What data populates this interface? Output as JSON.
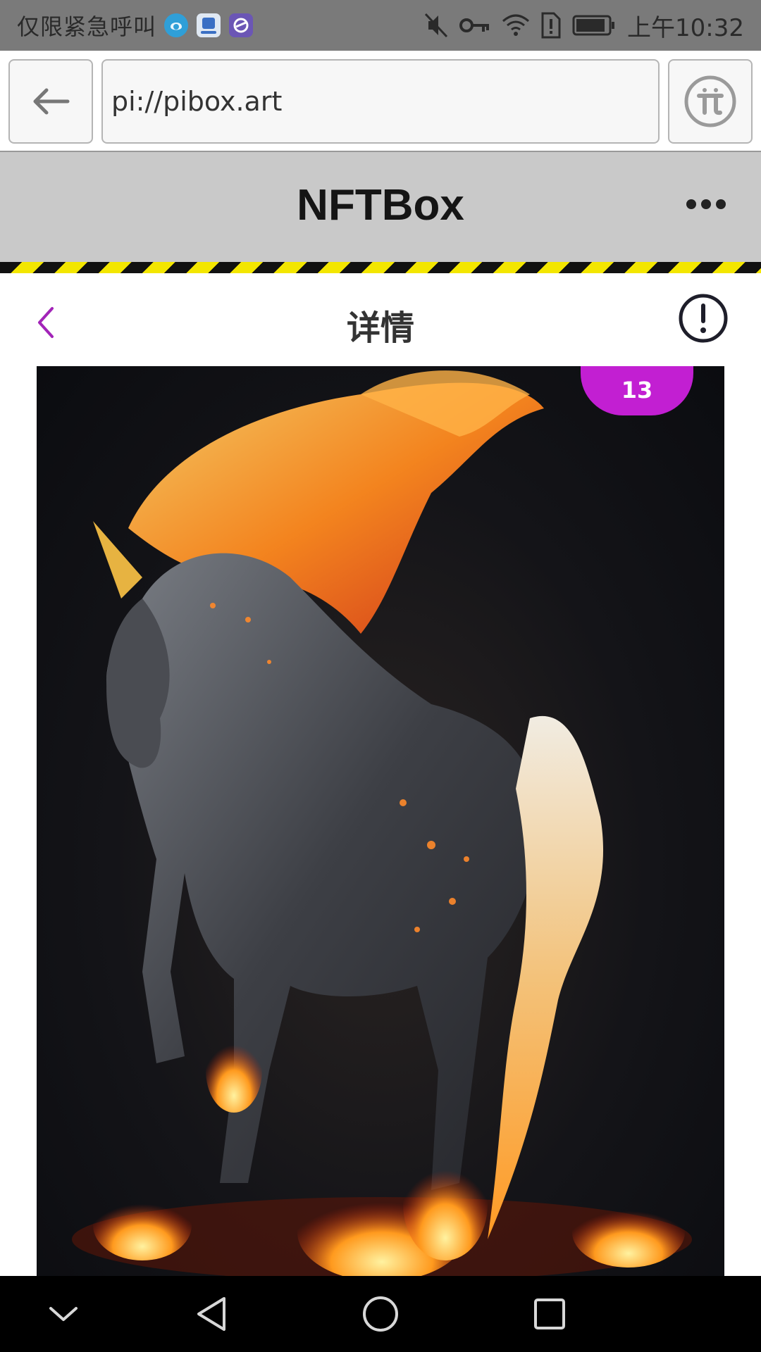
{
  "status_bar": {
    "carrier_text": "仅限紧急呼叫",
    "time": "上午10:32",
    "icons": [
      "weibo-icon",
      "app-store-icon",
      "browser-icon",
      "mute-icon",
      "vpn-key-icon",
      "wifi-icon",
      "sim-alert-icon",
      "battery-icon"
    ]
  },
  "browser": {
    "url": "pi://pibox.art",
    "icons": [
      "back-arrow-icon",
      "pi-logo-icon"
    ]
  },
  "app_header": {
    "title": "NFTBox",
    "more_icon": "more-dots-icon"
  },
  "page_nav": {
    "title": "详情",
    "icons": [
      "chevron-left-icon",
      "info-exclamation-icon"
    ]
  },
  "artwork": {
    "badge": "13",
    "subject": "fire-unicorn-artwork"
  },
  "system_nav": {
    "icons": [
      "chevron-down-icon",
      "back-triangle-icon",
      "home-circle-icon",
      "recents-square-icon"
    ]
  },
  "colors": {
    "accent": "#c21fd2",
    "header_bg": "#c9c9c9",
    "stripe_yellow": "#f3e600"
  }
}
